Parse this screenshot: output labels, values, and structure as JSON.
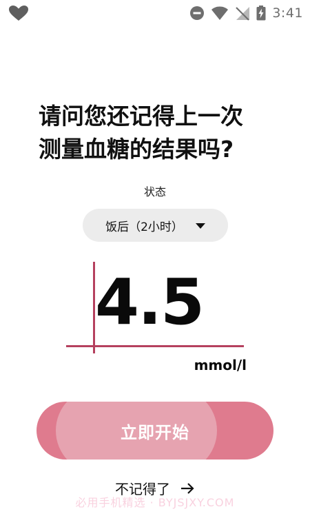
{
  "status_bar": {
    "time": "3:41",
    "icons": [
      "dnd-icon",
      "wifi-icon",
      "no-signal-icon",
      "battery-charging-icon"
    ]
  },
  "app_icon": "heart-icon",
  "question": {
    "line1": "请问您还记得上一次",
    "line2": "测量血糖的结果吗?"
  },
  "state": {
    "label": "状态",
    "selected": "饭后（2小时）"
  },
  "measurement": {
    "value": "4.5",
    "unit": "mmol/l"
  },
  "start_button": {
    "label": "立即开始"
  },
  "forgot_link": {
    "label": "不记得了",
    "arrow": "→"
  },
  "watermark": "必用手机精选 · BYJSJXY.COM",
  "colors": {
    "accent": "#b5405e",
    "button_outer": "#df7b8e",
    "button_inner": "#e6a3b0",
    "select_bg": "#ececec"
  }
}
